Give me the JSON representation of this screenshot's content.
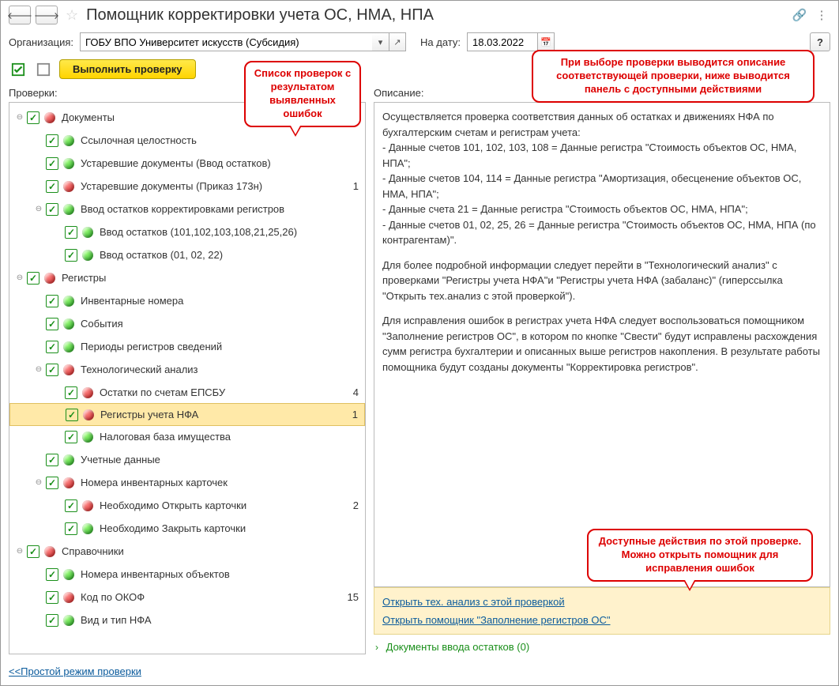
{
  "title": "Помощник корректировки учета ОС, НМА, НПА",
  "filter": {
    "org_label": "Организация:",
    "org_value": "ГОБУ ВПО Университет искусств (Субсидия)",
    "date_label": "На дату:",
    "date_value": "18.03.2022"
  },
  "toolbar": {
    "run_label": "Выполнить проверку"
  },
  "left": {
    "label": "Проверки:"
  },
  "right": {
    "label": "Описание:"
  },
  "tree": [
    {
      "level": 0,
      "expand": "-",
      "status": "red",
      "label": "Документы",
      "count": ""
    },
    {
      "level": 1,
      "expand": "",
      "status": "green",
      "label": "Ссылочная целостность",
      "count": ""
    },
    {
      "level": 1,
      "expand": "",
      "status": "green",
      "label": "Устаревшие документы (Ввод остатков)",
      "count": ""
    },
    {
      "level": 1,
      "expand": "",
      "status": "red",
      "label": "Устаревшие документы (Приказ 173н)",
      "count": "1"
    },
    {
      "level": 1,
      "expand": "-",
      "status": "green",
      "label": "Ввод остатков корректировками регистров",
      "count": ""
    },
    {
      "level": 2,
      "expand": "",
      "status": "green",
      "label": "Ввод остатков (101,102,103,108,21,25,26)",
      "count": ""
    },
    {
      "level": 2,
      "expand": "",
      "status": "green",
      "label": "Ввод остатков (01, 02, 22)",
      "count": ""
    },
    {
      "level": 0,
      "expand": "-",
      "status": "red",
      "label": "Регистры",
      "count": ""
    },
    {
      "level": 1,
      "expand": "",
      "status": "green",
      "label": "Инвентарные номера",
      "count": ""
    },
    {
      "level": 1,
      "expand": "",
      "status": "green",
      "label": "События",
      "count": ""
    },
    {
      "level": 1,
      "expand": "",
      "status": "green",
      "label": "Периоды регистров сведений",
      "count": ""
    },
    {
      "level": 1,
      "expand": "-",
      "status": "red",
      "label": "Технологический анализ",
      "count": ""
    },
    {
      "level": 2,
      "expand": "",
      "status": "red",
      "label": "Остатки по счетам ЕПСБУ",
      "count": "4"
    },
    {
      "level": 2,
      "expand": "",
      "status": "red",
      "label": "Регистры учета НФА",
      "count": "1",
      "selected": true
    },
    {
      "level": 2,
      "expand": "",
      "status": "green",
      "label": "Налоговая база имущества",
      "count": ""
    },
    {
      "level": 1,
      "expand": "",
      "status": "green",
      "label": "Учетные данные",
      "count": ""
    },
    {
      "level": 1,
      "expand": "-",
      "status": "red",
      "label": "Номера инвентарных карточек",
      "count": ""
    },
    {
      "level": 2,
      "expand": "",
      "status": "red",
      "label": "Необходимо Открыть карточки",
      "count": "2"
    },
    {
      "level": 2,
      "expand": "",
      "status": "green",
      "label": "Необходимо Закрыть карточки",
      "count": ""
    },
    {
      "level": 0,
      "expand": "-",
      "status": "red",
      "label": "Справочники",
      "count": ""
    },
    {
      "level": 1,
      "expand": "",
      "status": "green",
      "label": "Номера инвентарных объектов",
      "count": ""
    },
    {
      "level": 1,
      "expand": "",
      "status": "red",
      "label": "Код по ОКОФ",
      "count": "15"
    },
    {
      "level": 1,
      "expand": "",
      "status": "green",
      "label": "Вид и тип НФА",
      "count": ""
    }
  ],
  "description": {
    "p1": "Осуществляется проверка соответствия данных об остатках и движениях НФА по бухгалтерским счетам и регистрам учета:",
    "b1": "   - Данные счетов 101, 102, 103, 108 = Данные регистра \"Стоимость объектов ОС, НМА, НПА\";",
    "b2": "   - Данные счетов 104, 114 = Данные регистра \"Амортизация, обесценение объектов ОС, НМА, НПА\";",
    "b3": "   - Данные счета 21 = Данные регистра \"Стоимость объектов ОС, НМА, НПА\";",
    "b4": "   - Данные счетов 01, 02, 25, 26 = Данные регистра \"Стоимость объектов ОС, НМА, НПА (по контрагентам)\".",
    "p2": "Для более подробной информации следует перейти в \"Технологический анализ\" с проверками \"Регистры учета НФА\"и \"Регистры учета НФА (забаланс)\" (гиперссылка \"Открыть тех.анализ с этой проверкой\").",
    "p3": "Для исправления ошибок в регистрах учета НФА следует воспользоваться помощником \"Заполнение регистров ОС\", в котором по кнопке \"Свести\" будут исправлены расхождения сумм регистра бухгалтерии и описанных выше регистров накопления. В результате работы помощника будут созданы документы \"Корректировка регистров\"."
  },
  "actions": {
    "a1": "Открыть тех. анализ с этой проверкой",
    "a2": "Открыть помощник \"Заполнение регистров ОС\""
  },
  "expander": {
    "label": "Документы ввода остатков (0)"
  },
  "bottom_link": "<<Простой режим проверки",
  "callouts": {
    "c1": "Список проверок с результатом выявленных ошибок",
    "c2": "При выборе проверки выводится описание соответствующей проверки, ниже выводится панель с доступными действиями",
    "c3": "Доступные действия по этой проверке. Можно открыть помощник для исправления ошибок"
  }
}
